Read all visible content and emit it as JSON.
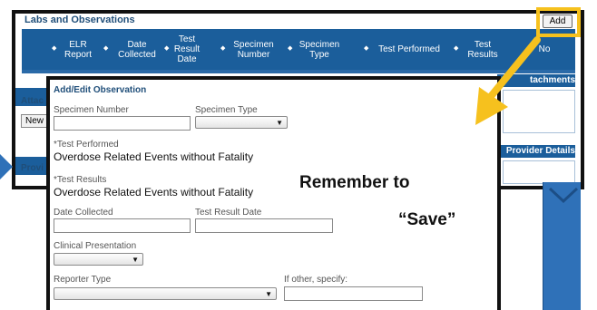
{
  "labs": {
    "title": "Labs and Observations",
    "add_label": "Add",
    "columns": [
      {
        "label": "ELR Report"
      },
      {
        "label": "Date Collected"
      },
      {
        "label": "Test Result Date"
      },
      {
        "label": "Specimen Number"
      },
      {
        "label": "Specimen Type"
      },
      {
        "label": "Test Performed"
      },
      {
        "label": "Test Results"
      },
      {
        "label": "No"
      }
    ]
  },
  "attachments": {
    "left_label": "Attac",
    "right_label": "tachments",
    "new_label": "New"
  },
  "provider": {
    "left_label": "Provi",
    "right_label": "Provider Details"
  },
  "modal": {
    "title": "Add/Edit Observation",
    "specimen_number_label": "Specimen Number",
    "specimen_number_value": "",
    "specimen_type_label": "Specimen Type",
    "specimen_type_value": "",
    "test_performed_label": "*Test Performed",
    "test_performed_value": "Overdose Related Events without Fatality",
    "test_results_label": "*Test Results",
    "test_results_value": "Overdose Related Events without Fatality",
    "date_collected_label": "Date Collected",
    "date_collected_value": "",
    "test_result_date_label": "Test Result Date",
    "test_result_date_value": "",
    "clinical_presentation_label": "Clinical Presentation",
    "clinical_presentation_value": "",
    "reporter_type_label": "Reporter Type",
    "reporter_type_value": "",
    "if_other_label": "If other, specify:",
    "if_other_value": ""
  },
  "callout": {
    "line1": "Remember to",
    "line2": "“Save”",
    "highlight_color": "#f6c11e"
  },
  "colors": {
    "header_blue": "#1b5e9b",
    "title_blue": "#1f4e79",
    "side_panel_blue": "#2f71b8"
  },
  "icons": {
    "sort": "sort-updown-icon",
    "dropdown": "caret-down-icon",
    "arrow": "callout-arrow-icon"
  }
}
